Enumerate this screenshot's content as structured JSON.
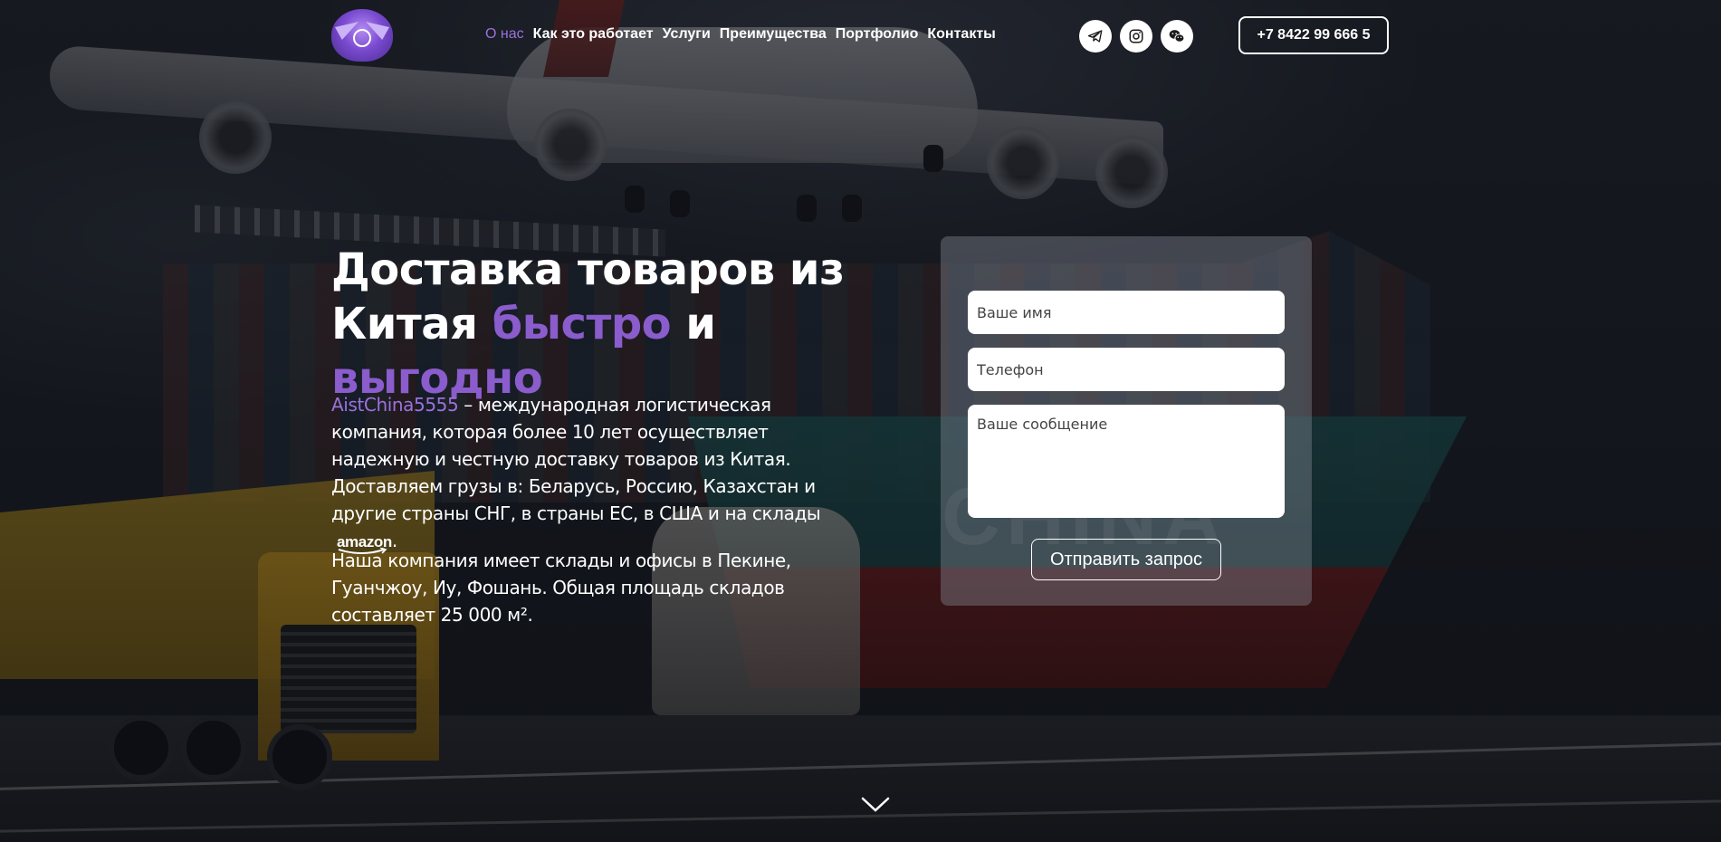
{
  "header": {
    "logo_icon": "stork-wings-logo-icon",
    "nav": [
      {
        "label": "О нас",
        "active": true
      },
      {
        "label": "Как это работает",
        "active": false
      },
      {
        "label": "Услуги",
        "active": false
      },
      {
        "label": "Преимущества",
        "active": false
      },
      {
        "label": "Портфолио",
        "active": false
      },
      {
        "label": "Контакты",
        "active": false
      }
    ],
    "social": [
      "telegram-icon",
      "instagram-icon",
      "wechat-icon"
    ],
    "phone": "+7 8422 99 666 5"
  },
  "hero": {
    "title_part1": "Доставка товаров из Китая",
    "title_accent1": "быстро",
    "title_and": "и",
    "title_accent2": "выгодно",
    "brand": "AistChina5555",
    "desc1": "– международная логистическая компания, которая более 10 лет осуществляет надежную и честную доставку товаров из Китая. Доставляем грузы в: Беларусь, Россию, Казахстан и другие страны СНГ, в страны ЕС, в США и на склады",
    "amazon_logo_text": "amazon",
    "desc1_end": ".",
    "desc2": "Наша компания имеет склады и офисы в Пекине, Гуанчжоу, Иу, Фошань. Общая площадь складов составляет 25 000 м²."
  },
  "form": {
    "name_placeholder": "Ваше имя",
    "phone_placeholder": "Телефон",
    "message_placeholder": "Ваше сообщение",
    "submit_label": "Отправить запрос"
  },
  "colors": {
    "accent": "#8a5ccc",
    "nav_active": "#9b71dd"
  },
  "scroll_icon": "chevron-down-icon"
}
